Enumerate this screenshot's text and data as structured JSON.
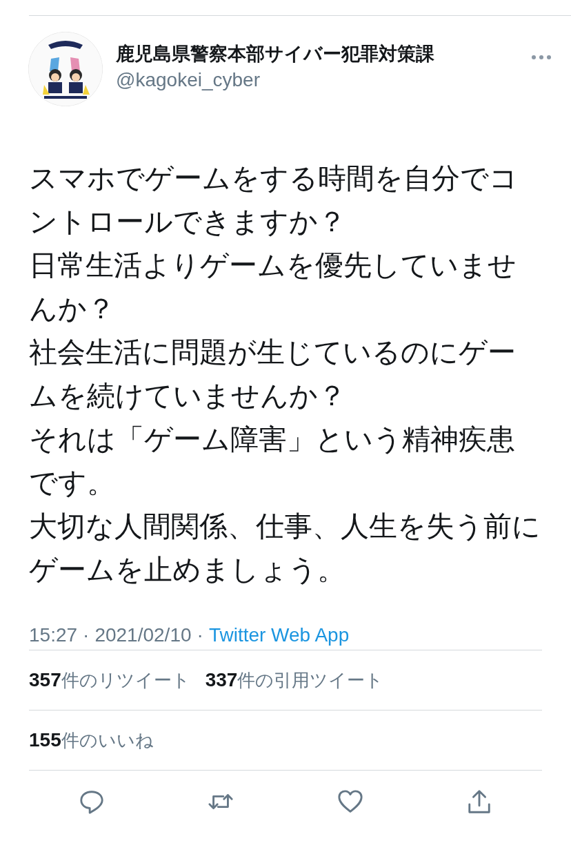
{
  "author": {
    "name": "鹿児島県警察本部サイバー犯罪対策課",
    "handle": "@kagokei_cyber"
  },
  "tweet": {
    "paragraphs": [
      "スマホでゲームをする時間を自分でコントロールできますか？",
      "日常生活よりゲームを優先していませんか？",
      "社会生活に問題が生じているのにゲームを続けていませんか？",
      "それは「ゲーム障害」という精神疾患です。",
      "大切な人間関係、仕事、人生を失う前にゲームを止めましょう。"
    ]
  },
  "meta": {
    "time": "15:27",
    "date": "2021/02/10",
    "source": "Twitter Web App",
    "separator": "·"
  },
  "stats": [
    [
      {
        "count": "357",
        "label": "件のリツイート"
      },
      {
        "count": "337",
        "label": "件の引用ツイート"
      }
    ],
    [
      {
        "count": "155",
        "label": "件のいいね"
      }
    ]
  ],
  "actions": [
    {
      "kind": "reply"
    },
    {
      "kind": "retweet"
    },
    {
      "kind": "like"
    },
    {
      "kind": "share"
    }
  ]
}
